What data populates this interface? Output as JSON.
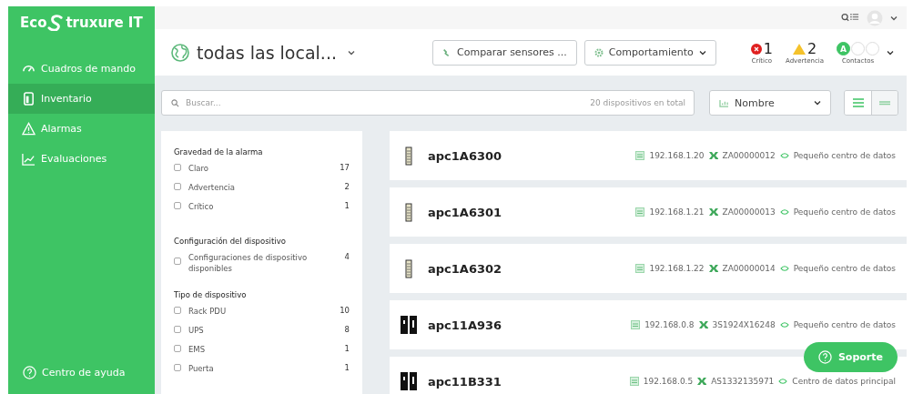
{
  "sidebar": {
    "logo": {
      "prefix": "Eco",
      "suffix": "truxure IT"
    },
    "items": [
      {
        "label": "Cuadros de mando",
        "kind": "dashboard",
        "selected": false
      },
      {
        "label": "Inventario",
        "kind": "inventory",
        "selected": true
      },
      {
        "label": "Alarmas",
        "kind": "alarm",
        "selected": false
      },
      {
        "label": "Evaluaciones",
        "kind": "chart",
        "selected": false
      }
    ],
    "help": "Centro de ayuda"
  },
  "header": {
    "location": "todas las local...",
    "buttons": [
      {
        "label": "Comparar sensores ...",
        "kind": "compare"
      },
      {
        "label": "Comportamiento",
        "kind": "menu"
      }
    ],
    "status": [
      {
        "kind": "critical",
        "count": "1",
        "label": "Crítico"
      },
      {
        "kind": "warning",
        "count": "2",
        "label": "Advertencia"
      }
    ],
    "contacts": {
      "label": "Contactos",
      "initial": "A"
    }
  },
  "toolbar": {
    "search": {
      "placeholder": "Buscar...",
      "total": "20 dispositivos en total"
    },
    "sort": "Nombre",
    "views": [
      {
        "kind": "list",
        "selected": true
      },
      {
        "kind": "compact",
        "selected": false
      }
    ]
  },
  "filters": [
    {
      "title": "Gravedad de la alarma",
      "options": [
        {
          "label": "Claro",
          "count": "17",
          "checked": false
        },
        {
          "label": "Advertencia",
          "count": "2",
          "checked": false
        },
        {
          "label": "Crítico",
          "count": "1",
          "checked": false
        }
      ]
    },
    {
      "title": "Configuración del dispositivo",
      "options": [
        {
          "label": "Configuraciones de dispositivo disponibles",
          "count": "4",
          "checked": false
        }
      ]
    },
    {
      "title": "Tipo de dispositivo",
      "options": [
        {
          "label": "Rack PDU",
          "count": "10",
          "checked": false
        },
        {
          "label": "UPS",
          "count": "8",
          "checked": false
        },
        {
          "label": "EMS",
          "count": "1",
          "checked": false
        },
        {
          "label": "Puerta",
          "count": "1",
          "checked": false
        }
      ]
    }
  ],
  "devices": [
    {
      "name": "apc1A6300",
      "kind": "pdu",
      "ip": "192.168.1.20",
      "serial": "ZA00000012",
      "location": "Pequeño centro de datos"
    },
    {
      "name": "apc1A6301",
      "kind": "pdu",
      "ip": "192.168.1.21",
      "serial": "ZA00000013",
      "location": "Pequeño centro de datos"
    },
    {
      "name": "apc1A6302",
      "kind": "pdu",
      "ip": "192.168.1.22",
      "serial": "ZA00000014",
      "location": "Pequeño centro de datos"
    },
    {
      "name": "apc11A936",
      "kind": "ups",
      "ip": "192.168.0.8",
      "serial": "3S1924X16248",
      "location": "Pequeño centro de datos"
    },
    {
      "name": "apc11B331",
      "kind": "ups",
      "ip": "192.168.0.5",
      "serial": "AS1332135971",
      "location": "Centro de datos principal"
    }
  ],
  "support": "Soporte"
}
